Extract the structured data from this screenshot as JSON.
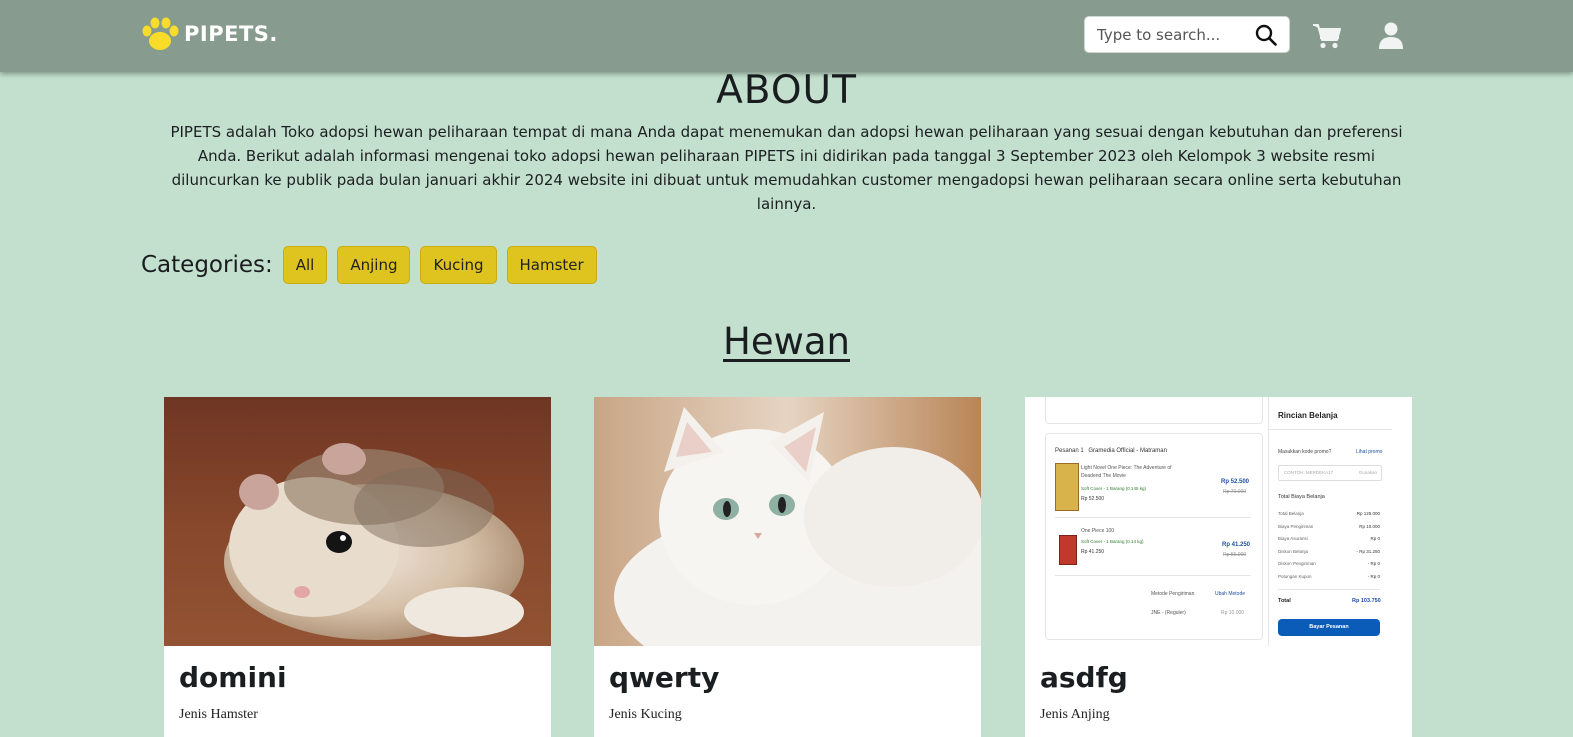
{
  "header": {
    "brand": "PIPETS.",
    "search_placeholder": "Type to search..."
  },
  "about": {
    "title": "ABOUT",
    "text": "PIPETS adalah Toko adopsi hewan peliharaan tempat di mana Anda dapat menemukan dan adopsi hewan peliharaan yang sesuai dengan kebutuhan dan preferensi Anda. Berikut adalah informasi mengenai toko adopsi hewan peliharaan PIPETS ini didirikan pada tanggal 3 September 2023 oleh Kelompok 3 website resmi diluncurkan ke publik pada bulan januari akhir 2024 website ini dibuat untuk memudahkan customer mengadopsi hewan peliharaan secara online serta kebutuhan lainnya."
  },
  "categories": {
    "label": "Categories:",
    "items": [
      "All",
      "Anjing",
      "Kucing",
      "Hamster"
    ]
  },
  "section": {
    "title": "Hewan"
  },
  "cards": [
    {
      "name": "domini",
      "jenis": "Jenis Hamster"
    },
    {
      "name": "qwerty",
      "jenis": "Jenis Kucing"
    },
    {
      "name": "asdfg",
      "jenis": "Jenis Anjing"
    }
  ],
  "receipt": {
    "summary_title": "Rincian Belanja",
    "promo_label": "Masukkan kode promo?",
    "promo_link": "Lihat promo",
    "promo_placeholder": "CONTOH: MERDEKA17",
    "apply": "Gunakan",
    "total_label": "Total Biaya Belanja",
    "rows": [
      {
        "k": "Total Belanja",
        "v": "Rp 125.000"
      },
      {
        "k": "Biaya Pengiriman",
        "v": "Rp 10.000"
      },
      {
        "k": "Biaya Asuransi",
        "v": "Rp 0"
      },
      {
        "k": "Diskon Belanja",
        "v": "- Rp 31.250"
      },
      {
        "k": "Diskon Pengiriman",
        "v": "- Rp 0"
      },
      {
        "k": "Potongan Kupon",
        "v": "- Rp 0"
      }
    ],
    "grand_label": "Total",
    "grand_value": "Rp 103.750",
    "pay_button": "Bayar Pesanan",
    "order_label": "Pesanan 1",
    "seller": "Gramedia Official - Matraman",
    "item1_title": "Light Novel One Piece: The Adventure of Deadend The Movie",
    "item1_meta": "Soft Cover - 1 Barang (0.145 kg)",
    "item1_price": "Rp 52.500",
    "item1_old": "Rp 70.000",
    "item1_price_small": "Rp 52.500",
    "item2_title": "One Piece 100",
    "item2_meta": "Soft Cover - 1 Barang (0.14 kg)",
    "item2_price": "Rp 41.250",
    "item2_old": "Rp 55.000",
    "item2_price_small": "Rp 41.250",
    "shipping_label": "Metode Pengiriman",
    "shipping_link": "Ubah Metode",
    "shipping_method": "JNE - (Reguler)",
    "shipping_cost": "Rp 10.000"
  },
  "colors": {
    "header_bg": "#879b8f",
    "page_bg": "#c3e0ce",
    "category_button": "#dfc31f",
    "paw_yellow": "#f7dd2a"
  },
  "icons": [
    "paw-icon",
    "search-icon",
    "cart-icon",
    "user-icon"
  ]
}
